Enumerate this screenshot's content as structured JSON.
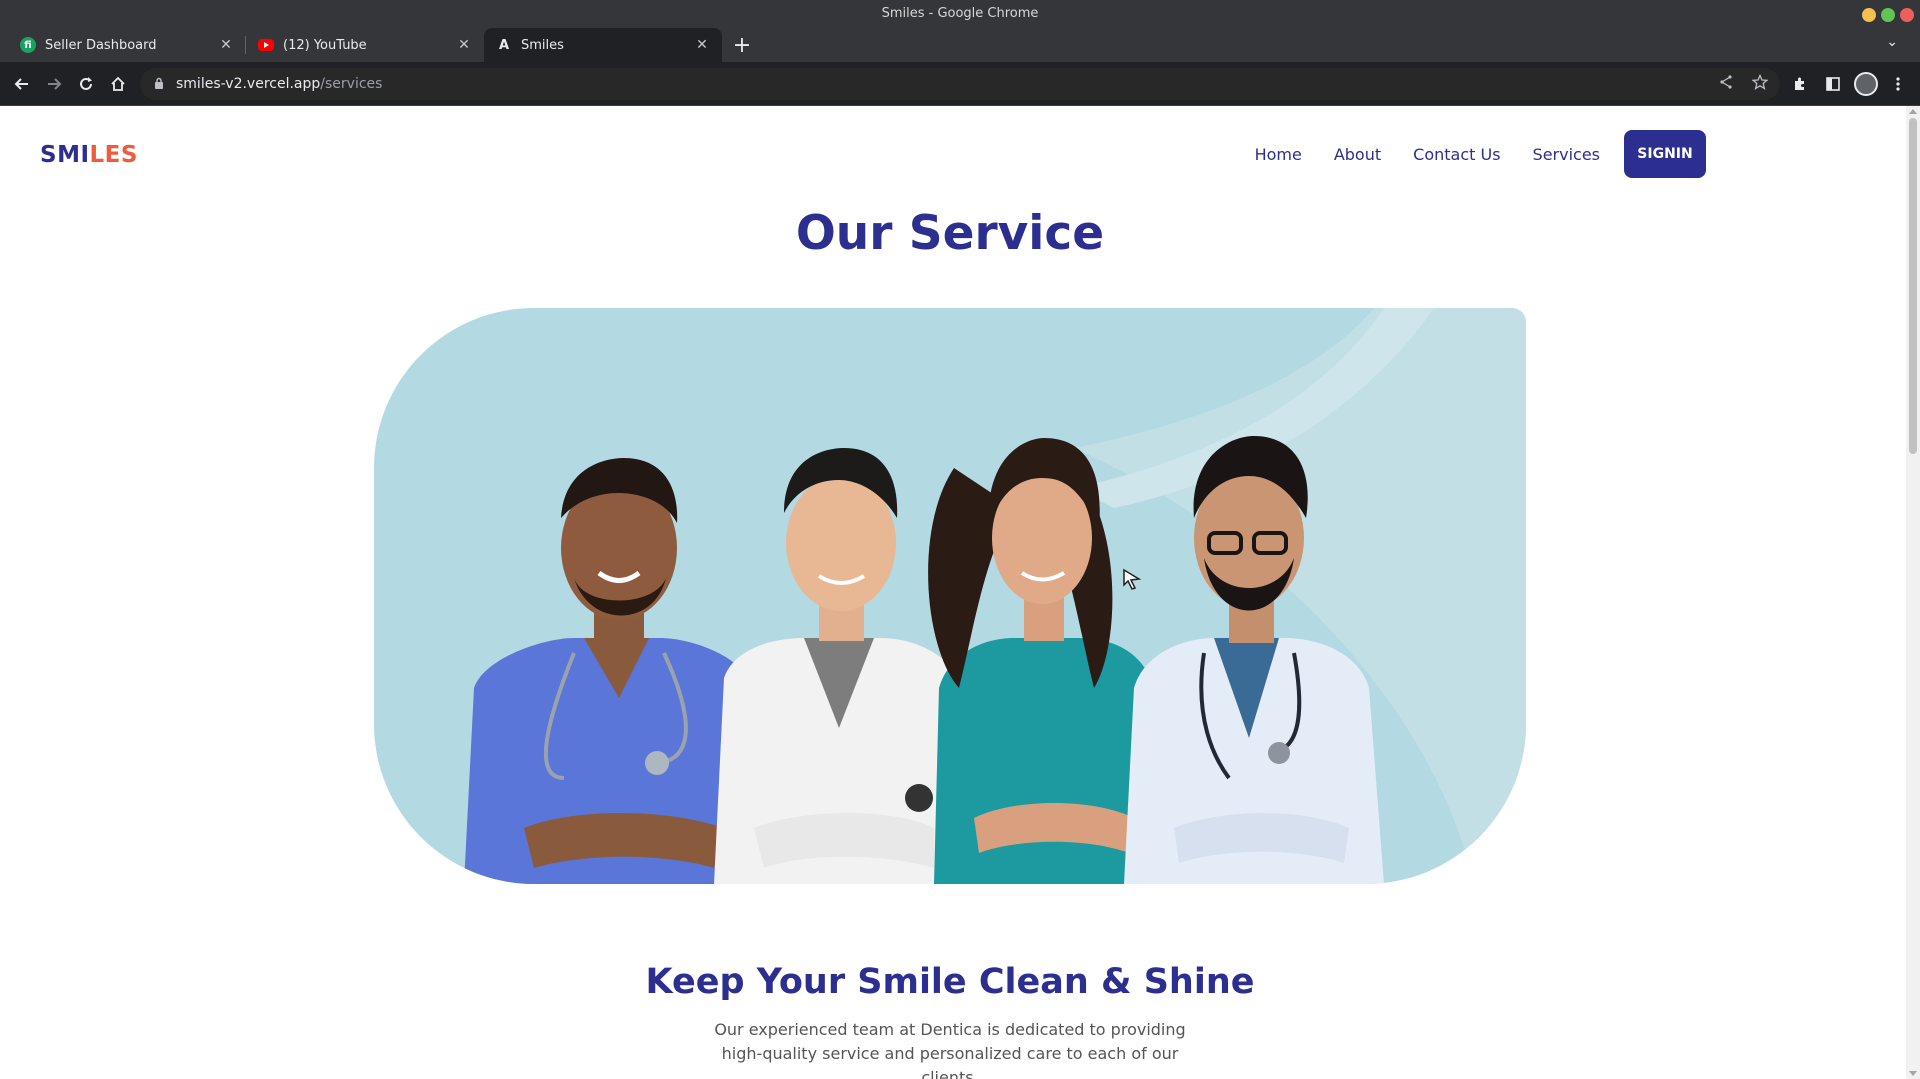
{
  "window": {
    "title": "Smiles - Google Chrome",
    "controls": {
      "minimize_color": "#f5bf4f",
      "maximize_color": "#61c554",
      "close_color": "#ec5f5e"
    }
  },
  "tabs": [
    {
      "label": "Seller Dashboard",
      "favicon": "seller-dashboard-favicon",
      "favicon_color": "#1aa260",
      "active": false
    },
    {
      "label": "(12) YouTube",
      "favicon": "youtube-favicon",
      "favicon_color": "#ff0000",
      "active": false
    },
    {
      "label": "Smiles",
      "favicon": "smiles-favicon",
      "favicon_color": "#e8eaed",
      "active": true
    }
  ],
  "toolbar": {
    "url_host": "smiles-v2.vercel.app",
    "url_path": "/services",
    "icons": [
      "back-icon",
      "forward-icon",
      "reload-icon",
      "home-icon",
      "share-icon",
      "bookmark-star-icon",
      "extensions-icon",
      "side-panel-icon",
      "profile-avatar",
      "menu-kebab-icon"
    ]
  },
  "site": {
    "logo_part1": "SMI",
    "logo_part2": "LES",
    "nav": {
      "home": "Home",
      "about": "About",
      "contact": "Contact Us",
      "services": "Services",
      "signin": "SIGNIN"
    },
    "page_title": "Our Service",
    "section_title": "Keep Your Smile Clean & Shine",
    "section_text": "Our experienced team at Dentica is dedicated to providing high-quality service and personalized care to each of our clients."
  },
  "colors": {
    "brand_primary": "#2c2f8f",
    "brand_accent": "#ef5b3c",
    "hero_bg": "#b3d9e3"
  }
}
